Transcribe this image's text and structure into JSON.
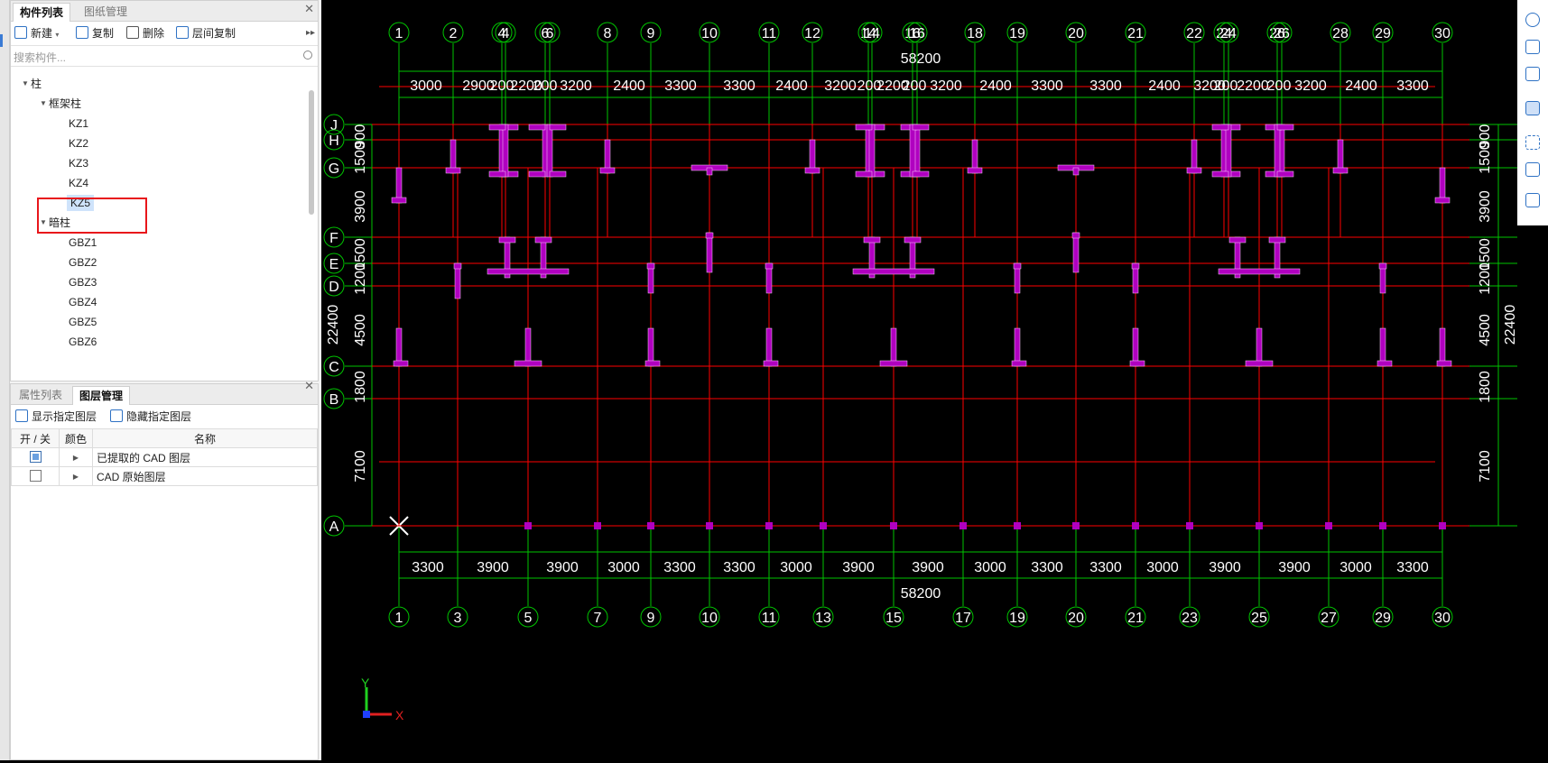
{
  "components_panel": {
    "tabs": [
      "构件列表",
      "图纸管理"
    ],
    "toolbar": {
      "new_label": "新建",
      "copy_label": "复制",
      "delete_label": "删除",
      "floor_copy_label": "层间复制"
    },
    "search_placeholder": "搜索构件...",
    "tree": {
      "root": "柱",
      "group1": {
        "label": "框架柱",
        "items": [
          "KZ1",
          "KZ2",
          "KZ3",
          "KZ4",
          "KZ5"
        ]
      },
      "selected": "KZ5",
      "group2": {
        "label": "暗柱",
        "items": [
          "GBZ1",
          "GBZ2",
          "GBZ3",
          "GBZ4",
          "GBZ5",
          "GBZ6"
        ]
      }
    }
  },
  "layers_panel": {
    "tabs": [
      "属性列表",
      "图层管理"
    ],
    "show_label": "显示指定图层",
    "hide_label": "隐藏指定图层",
    "columns": [
      "开 / 关",
      "颜色",
      "名称"
    ],
    "rows": [
      {
        "on": true,
        "name": "已提取的 CAD 图层"
      },
      {
        "on": false,
        "name": "CAD 原始图层"
      }
    ]
  },
  "drawing": {
    "top_axes": [
      "1",
      "2",
      "4",
      "4",
      "6",
      "6",
      "8",
      "9",
      "10",
      "11",
      "12",
      "14",
      "14",
      "16",
      "16",
      "18",
      "19",
      "20",
      "21",
      "22",
      "24",
      "24",
      "26",
      "26",
      "28",
      "29",
      "30"
    ],
    "bottom_axes": [
      "1",
      "3",
      "5",
      "7",
      "9",
      "10",
      "11",
      "13",
      "15",
      "17",
      "19",
      "20",
      "21",
      "23",
      "25",
      "27",
      "29",
      "30"
    ],
    "row_axes": [
      "J",
      "H",
      "G",
      "F",
      "E",
      "D",
      "C",
      "B",
      "A"
    ],
    "total_width": "58200",
    "top_dims": [
      "3000",
      "2900",
      "200",
      "2200",
      "200",
      "3200",
      "2400",
      "3300",
      "3300",
      "2400",
      "3200",
      "200",
      "2200",
      "200",
      "3200",
      "2400",
      "3300",
      "3300",
      "2400",
      "3200",
      "200",
      "2200",
      "200",
      "3200",
      "2400",
      "3300"
    ],
    "bottom_dims": [
      "3300",
      "3900",
      "3900",
      "3000",
      "3300",
      "3300",
      "3000",
      "3900",
      "3900",
      "3000",
      "3300",
      "3300",
      "3000",
      "3900",
      "3900",
      "3000",
      "3300"
    ],
    "left_dims": [
      "900",
      "1500",
      "3900",
      "1500",
      "1200",
      "4500",
      "1800",
      "7100"
    ],
    "total_depth": "22400",
    "ucs": {
      "x": "X",
      "y": "Y"
    },
    "colors": {
      "axis": "#00c400",
      "wall": "#ff0000",
      "column": "#b000c0",
      "background": "#000000"
    }
  }
}
